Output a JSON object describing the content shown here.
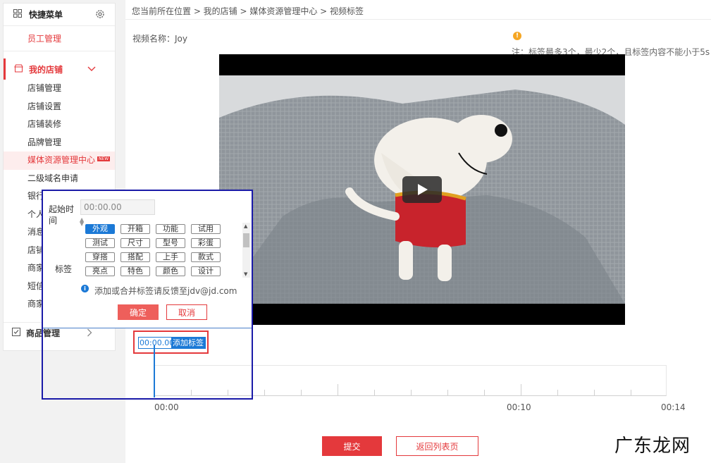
{
  "sidebar": {
    "quick_menu": "快捷菜单",
    "staff": "员工管理",
    "shop": {
      "title": "我的店铺",
      "items": [
        {
          "label": "店铺管理"
        },
        {
          "label": "店铺设置"
        },
        {
          "label": "店铺装修"
        },
        {
          "label": "品牌管理"
        },
        {
          "label": "媒体资源管理中心",
          "badge": "NEW",
          "active": true
        },
        {
          "label": "二级域名申请"
        },
        {
          "label": "银行"
        },
        {
          "label": "个人"
        },
        {
          "label": "消息"
        },
        {
          "label": "店铺"
        },
        {
          "label": "商家"
        },
        {
          "label": "短信"
        },
        {
          "label": "商家"
        }
      ]
    },
    "goods": "商品管理"
  },
  "breadcrumb": "您当前所在位置 > 我的店铺 > 媒体资源管理中心 > 视频标签",
  "video": {
    "name_label": "视频名称：Joy",
    "note": "注：标签最多3个，最少2个，且标签内容不能小于5s"
  },
  "tag_entry": {
    "time": "00:00.00",
    "add_label": "添加标签"
  },
  "timeline": {
    "labels": [
      "00:00",
      "00:10",
      "00:14"
    ],
    "duration_s": 14,
    "cursor_s": 0
  },
  "popup": {
    "start_time_label": "起始时间",
    "start_time_value": "00:00.00",
    "tags_label": "标签",
    "tags": [
      "外观",
      "开箱",
      "功能",
      "试用",
      "测试",
      "尺寸",
      "型号",
      "彩蛋",
      "穿搭",
      "搭配",
      "上手",
      "款式",
      "亮点",
      "特色",
      "颜色",
      "设计"
    ],
    "selected_tag": "外观",
    "info": "添加或合并标签请反馈至jdv@jd.com",
    "confirm": "确定",
    "cancel": "取消"
  },
  "buttons": {
    "submit": "提交",
    "back": "返回列表页"
  },
  "watermark": "广东龙网",
  "colors": {
    "accent": "#e4393c",
    "link_blue": "#1b79d6",
    "popup_border": "#1a1aa8"
  }
}
